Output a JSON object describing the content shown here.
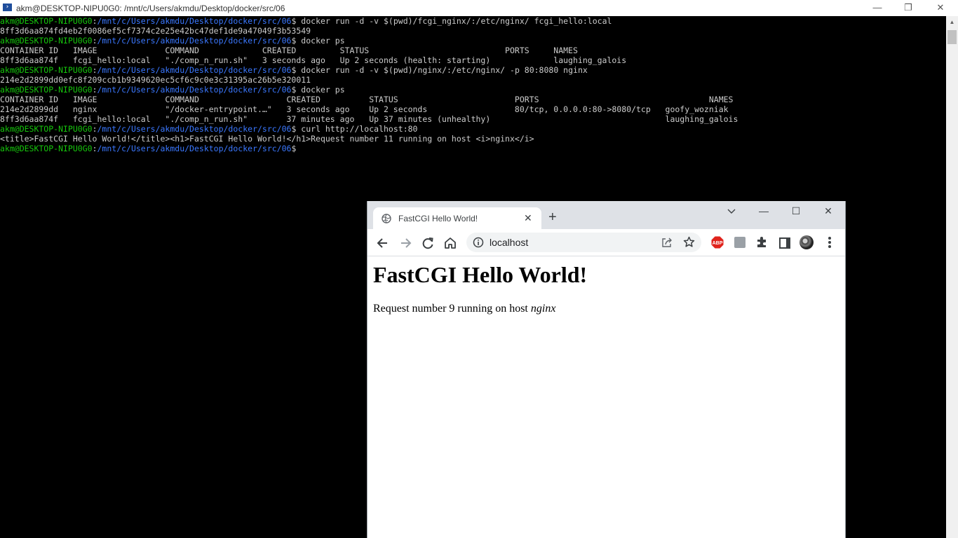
{
  "terminal": {
    "title": "akm@DESKTOP-NIPU0G0: /mnt/c/Users/akmdu/Desktop/docker/src/06",
    "icon": "powershell-icon",
    "prompt_user": "akm@DESKTOP-NIPU0G0",
    "prompt_path": "/mnt/c/Users/akmdu/Desktop/docker/src/06",
    "lines": [
      {
        "type": "cmd",
        "text": "docker run -d -v $(pwd)/fcgi_nginx/:/etc/nginx/ fcgi_hello:local"
      },
      {
        "type": "out",
        "text": "8ff3d6aa874fd4eb2f0086ef5cf7374c2e25e42bc47def1de9a47049f3b53549"
      },
      {
        "type": "cmd",
        "text": "docker ps"
      },
      {
        "type": "out",
        "text": "CONTAINER ID   IMAGE              COMMAND             CREATED         STATUS                            PORTS     NAMES"
      },
      {
        "type": "out",
        "text": "8ff3d6aa874f   fcgi_hello:local   \"./comp_n_run.sh\"   3 seconds ago   Up 2 seconds (health: starting)             laughing_galois"
      },
      {
        "type": "cmd",
        "text": "docker run -d -v $(pwd)/nginx/:/etc/nginx/ -p 80:8080 nginx"
      },
      {
        "type": "out",
        "text": "214e2d2899dd0efc8f209ccb1b9349620ec5cf6c9c0e3c31395ac26b5e320011"
      },
      {
        "type": "cmd",
        "text": "docker ps"
      },
      {
        "type": "out",
        "text": "CONTAINER ID   IMAGE              COMMAND                  CREATED          STATUS                        PORTS                                   NAMES"
      },
      {
        "type": "out",
        "text": "214e2d2899dd   nginx              \"/docker-entrypoint.…\"   3 seconds ago    Up 2 seconds                  80/tcp, 0.0.0.0:80->8080/tcp   goofy_wozniak"
      },
      {
        "type": "out",
        "text": "8ff3d6aa874f   fcgi_hello:local   \"./comp_n_run.sh\"        37 minutes ago   Up 37 minutes (unhealthy)                                    laughing_galois"
      },
      {
        "type": "cmd",
        "text": "curl http://localhost:80"
      },
      {
        "type": "out",
        "text": "<title>FastCGI Hello World!</title><h1>FastCGI Hello World!</h1>Request number 11 running on host <i>nginx</i>"
      },
      {
        "type": "cmd",
        "text": ""
      }
    ]
  },
  "browser": {
    "tab_title": "FastCGI Hello World!",
    "address": "localhost",
    "page_heading": "FastCGI Hello World!",
    "page_text": "Request number 9 running on host ",
    "page_host": "nginx"
  },
  "colors": {
    "prompt_user": "#16c60c",
    "prompt_path": "#3b78ff",
    "terminal_bg": "#000000",
    "abp_red": "#e0231c"
  }
}
